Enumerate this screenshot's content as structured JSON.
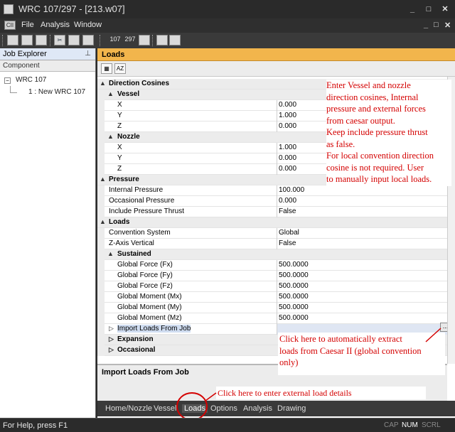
{
  "window": {
    "title": "WRC 107/297 - [213.w07]",
    "minimize": "_",
    "maximize": "□",
    "close": "✕"
  },
  "menu": {
    "items": [
      "File",
      "Analysis",
      "Window"
    ],
    "mdi": [
      "_",
      "□",
      "✕"
    ]
  },
  "toolbar": {
    "btn_107": "107",
    "btn_297": "297"
  },
  "job_explorer": {
    "title": "Job Explorer",
    "column": "Component",
    "root": "WRC 107",
    "child": "1 : New WRC 107"
  },
  "loads_panel": {
    "title": "Loads",
    "categories": {
      "direction": "Direction Cosines",
      "vessel": "Vessel",
      "nozzle": "Nozzle",
      "pressure": "Pressure",
      "loads": "Loads",
      "sustained": "Sustained",
      "expansion": "Expansion",
      "occasional": "Occasional"
    },
    "vessel": [
      {
        "name": "X",
        "value": "0.000"
      },
      {
        "name": "Y",
        "value": "1.000"
      },
      {
        "name": "Z",
        "value": "0.000"
      }
    ],
    "nozzle": [
      {
        "name": "X",
        "value": "1.000"
      },
      {
        "name": "Y",
        "value": "0.000"
      },
      {
        "name": "Z",
        "value": "0.000"
      }
    ],
    "pressure": [
      {
        "name": "Internal Pressure",
        "value": "100.000"
      },
      {
        "name": "Occasional Pressure",
        "value": "0.000"
      },
      {
        "name": "Include Pressure Thrust",
        "value": "False"
      }
    ],
    "loads": [
      {
        "name": "Convention System",
        "value": "Global"
      },
      {
        "name": "Z-Axis Vertical",
        "value": "False"
      }
    ],
    "sustained": [
      {
        "name": "Global Force (Fx)",
        "value": "500.0000"
      },
      {
        "name": "Global Force (Fy)",
        "value": "500.0000"
      },
      {
        "name": "Global Force (Fz)",
        "value": "500.0000"
      },
      {
        "name": "Global Moment (Mx)",
        "value": "500.0000"
      },
      {
        "name": "Global Moment (My)",
        "value": "500.0000"
      },
      {
        "name": "Global Moment (Mz)",
        "value": "500.0000"
      }
    ],
    "import_row": "Import Loads From Job",
    "ellipsis": "...",
    "description_title": "Import Loads From Job"
  },
  "tabs": [
    "Home/Nozzle",
    "Vessel",
    "Loads",
    "Options",
    "Analysis",
    "Drawing"
  ],
  "status": {
    "help": "For Help, press F1",
    "indicators": [
      "CAP",
      "NUM",
      "SCRL"
    ]
  },
  "annotations": {
    "top": [
      "Enter Vessel and nozzle",
      "direction cosines, Internal",
      "pressure and external forces",
      "from caesar output.",
      "Keep include pressure thrust",
      "as false.",
      "For local convention direction",
      "cosine is not required. User",
      "to manually input local loads."
    ],
    "import": [
      "Click here to automatically extract",
      "loads from Caesar II (global convention",
      "only)"
    ],
    "tab": "Click here to enter external load details"
  },
  "colors": {
    "accent": "#f2b54c",
    "annotation": "#d40000"
  }
}
